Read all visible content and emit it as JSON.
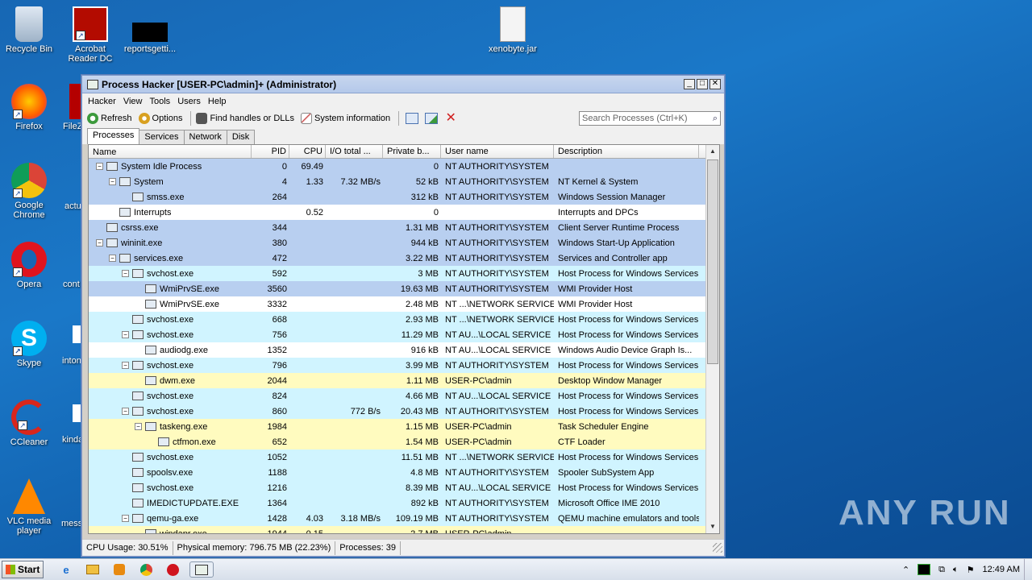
{
  "desktop": {
    "icons": [
      {
        "label": "Recycle Bin",
        "icon": "recycle-bin-icon"
      },
      {
        "label": "Acrobat Reader DC",
        "icon": "acrobat-icon"
      },
      {
        "label": "reportsgetti...",
        "icon": "file-icon"
      },
      {
        "label": "xenobyte.jar",
        "icon": "jar-icon"
      },
      {
        "label": "Firefox",
        "icon": "firefox-icon"
      },
      {
        "label": "FileZ",
        "icon": "filezilla-icon"
      },
      {
        "label": "Google Chrome",
        "icon": "chrome-icon"
      },
      {
        "label": "actu",
        "icon": "file-icon"
      },
      {
        "label": "Opera",
        "icon": "opera-icon"
      },
      {
        "label": "cont",
        "icon": "file-icon"
      },
      {
        "label": "Skype",
        "icon": "skype-icon"
      },
      {
        "label": "inton",
        "icon": "file-icon"
      },
      {
        "label": "CCleaner",
        "icon": "ccleaner-icon"
      },
      {
        "label": "kinda",
        "icon": "file-icon"
      },
      {
        "label": "VLC media player",
        "icon": "vlc-icon"
      },
      {
        "label": "mess",
        "icon": "file-icon"
      }
    ],
    "watermark": "ANY RUN"
  },
  "window": {
    "title": "Process Hacker [USER-PC\\admin]+ (Administrator)",
    "menu": [
      "Hacker",
      "View",
      "Tools",
      "Users",
      "Help"
    ],
    "toolbar": {
      "refresh": "Refresh",
      "options": "Options",
      "find_handles": "Find handles or DLLs",
      "system_info": "System information"
    },
    "search_placeholder": "Search Processes (Ctrl+K)",
    "tabs": [
      "Processes",
      "Services",
      "Network",
      "Disk"
    ],
    "columns": [
      "Name",
      "PID",
      "CPU",
      "I/O total ...",
      "Private b...",
      "User name",
      "Description"
    ],
    "rows": [
      {
        "depth": 0,
        "exp": "−",
        "name": "System Idle Process",
        "pid": "0",
        "cpu": "69.49",
        "io": "",
        "priv": "0",
        "user": "NT AUTHORITY\\SYSTEM",
        "desc": "",
        "bg": "blue"
      },
      {
        "depth": 1,
        "exp": "−",
        "name": "System",
        "pid": "4",
        "cpu": "1.33",
        "io": "7.32 MB/s",
        "priv": "52 kB",
        "user": "NT AUTHORITY\\SYSTEM",
        "desc": "NT Kernel & System",
        "bg": "blue"
      },
      {
        "depth": 2,
        "exp": "",
        "name": "smss.exe",
        "pid": "264",
        "cpu": "",
        "io": "",
        "priv": "312 kB",
        "user": "NT AUTHORITY\\SYSTEM",
        "desc": "Windows Session Manager",
        "bg": "blue"
      },
      {
        "depth": 1,
        "exp": "",
        "name": "Interrupts",
        "pid": "",
        "cpu": "0.52",
        "io": "",
        "priv": "0",
        "user": "",
        "desc": "Interrupts and DPCs",
        "bg": "white"
      },
      {
        "depth": 0,
        "exp": "",
        "name": "csrss.exe",
        "pid": "344",
        "cpu": "",
        "io": "",
        "priv": "1.31 MB",
        "user": "NT AUTHORITY\\SYSTEM",
        "desc": "Client Server Runtime Process",
        "bg": "blue"
      },
      {
        "depth": 0,
        "exp": "−",
        "name": "wininit.exe",
        "pid": "380",
        "cpu": "",
        "io": "",
        "priv": "944 kB",
        "user": "NT AUTHORITY\\SYSTEM",
        "desc": "Windows Start-Up Application",
        "bg": "blue"
      },
      {
        "depth": 1,
        "exp": "−",
        "name": "services.exe",
        "pid": "472",
        "cpu": "",
        "io": "",
        "priv": "3.22 MB",
        "user": "NT AUTHORITY\\SYSTEM",
        "desc": "Services and Controller app",
        "bg": "blue"
      },
      {
        "depth": 2,
        "exp": "−",
        "name": "svchost.exe",
        "pid": "592",
        "cpu": "",
        "io": "",
        "priv": "3 MB",
        "user": "NT AUTHORITY\\SYSTEM",
        "desc": "Host Process for Windows Services",
        "bg": "cyan"
      },
      {
        "depth": 3,
        "exp": "",
        "name": "WmiPrvSE.exe",
        "pid": "3560",
        "cpu": "",
        "io": "",
        "priv": "19.63 MB",
        "user": "NT AUTHORITY\\SYSTEM",
        "desc": "WMI Provider Host",
        "bg": "blue"
      },
      {
        "depth": 3,
        "exp": "",
        "name": "WmiPrvSE.exe",
        "pid": "3332",
        "cpu": "",
        "io": "",
        "priv": "2.48 MB",
        "user": "NT ...\\NETWORK SERVICE",
        "desc": "WMI Provider Host",
        "bg": "white"
      },
      {
        "depth": 2,
        "exp": "",
        "name": "svchost.exe",
        "pid": "668",
        "cpu": "",
        "io": "",
        "priv": "2.93 MB",
        "user": "NT ...\\NETWORK SERVICE",
        "desc": "Host Process for Windows Services",
        "bg": "cyan"
      },
      {
        "depth": 2,
        "exp": "−",
        "name": "svchost.exe",
        "pid": "756",
        "cpu": "",
        "io": "",
        "priv": "11.29 MB",
        "user": "NT AU...\\LOCAL SERVICE",
        "desc": "Host Process for Windows Services",
        "bg": "cyan"
      },
      {
        "depth": 3,
        "exp": "",
        "name": "audiodg.exe",
        "pid": "1352",
        "cpu": "",
        "io": "",
        "priv": "916 kB",
        "user": "NT AU...\\LOCAL SERVICE",
        "desc": "Windows Audio Device Graph Is...",
        "bg": "white"
      },
      {
        "depth": 2,
        "exp": "−",
        "name": "svchost.exe",
        "pid": "796",
        "cpu": "",
        "io": "",
        "priv": "3.99 MB",
        "user": "NT AUTHORITY\\SYSTEM",
        "desc": "Host Process for Windows Services",
        "bg": "cyan"
      },
      {
        "depth": 3,
        "exp": "",
        "name": "dwm.exe",
        "pid": "2044",
        "cpu": "",
        "io": "",
        "priv": "1.11 MB",
        "user": "USER-PC\\admin",
        "desc": "Desktop Window Manager",
        "bg": "yellow"
      },
      {
        "depth": 2,
        "exp": "",
        "name": "svchost.exe",
        "pid": "824",
        "cpu": "",
        "io": "",
        "priv": "4.66 MB",
        "user": "NT AU...\\LOCAL SERVICE",
        "desc": "Host Process for Windows Services",
        "bg": "cyan"
      },
      {
        "depth": 2,
        "exp": "−",
        "name": "svchost.exe",
        "pid": "860",
        "cpu": "",
        "io": "772 B/s",
        "priv": "20.43 MB",
        "user": "NT AUTHORITY\\SYSTEM",
        "desc": "Host Process for Windows Services",
        "bg": "cyan"
      },
      {
        "depth": 3,
        "exp": "−",
        "name": "taskeng.exe",
        "pid": "1984",
        "cpu": "",
        "io": "",
        "priv": "1.15 MB",
        "user": "USER-PC\\admin",
        "desc": "Task Scheduler Engine",
        "bg": "yellow"
      },
      {
        "depth": 4,
        "exp": "",
        "name": "ctfmon.exe",
        "pid": "652",
        "cpu": "",
        "io": "",
        "priv": "1.54 MB",
        "user": "USER-PC\\admin",
        "desc": "CTF Loader",
        "bg": "yellow"
      },
      {
        "depth": 2,
        "exp": "",
        "name": "svchost.exe",
        "pid": "1052",
        "cpu": "",
        "io": "",
        "priv": "11.51 MB",
        "user": "NT ...\\NETWORK SERVICE",
        "desc": "Host Process for Windows Services",
        "bg": "cyan"
      },
      {
        "depth": 2,
        "exp": "",
        "name": "spoolsv.exe",
        "pid": "1188",
        "cpu": "",
        "io": "",
        "priv": "4.8 MB",
        "user": "NT AUTHORITY\\SYSTEM",
        "desc": "Spooler SubSystem App",
        "bg": "cyan"
      },
      {
        "depth": 2,
        "exp": "",
        "name": "svchost.exe",
        "pid": "1216",
        "cpu": "",
        "io": "",
        "priv": "8.39 MB",
        "user": "NT AU...\\LOCAL SERVICE",
        "desc": "Host Process for Windows Services",
        "bg": "cyan"
      },
      {
        "depth": 2,
        "exp": "",
        "name": "IMEDICTUPDATE.EXE",
        "pid": "1364",
        "cpu": "",
        "io": "",
        "priv": "892 kB",
        "user": "NT AUTHORITY\\SYSTEM",
        "desc": "Microsoft Office IME 2010",
        "bg": "cyan"
      },
      {
        "depth": 2,
        "exp": "−",
        "name": "qemu-ga.exe",
        "pid": "1428",
        "cpu": "4.03",
        "io": "3.18 MB/s",
        "priv": "109.19 MB",
        "user": "NT AUTHORITY\\SYSTEM",
        "desc": "QEMU machine emulators and tools",
        "bg": "cyan"
      },
      {
        "depth": 3,
        "exp": "",
        "name": "windapr.exe",
        "pid": "1944",
        "cpu": "0.15",
        "io": "",
        "priv": "2.7 MB",
        "user": "USER-PC\\admin",
        "desc": "",
        "bg": "yellow"
      }
    ],
    "status": {
      "cpu": "CPU Usage: 30.51%",
      "memory": "Physical memory: 796.75 MB (22.23%)",
      "processes": "Processes: 39"
    }
  },
  "taskbar": {
    "start_label": "Start",
    "clock": "12:49 AM"
  },
  "colors": {
    "system_process": "#b8cff0",
    "service_process": "#d0f4ff",
    "user_process": "#fffbbf"
  }
}
